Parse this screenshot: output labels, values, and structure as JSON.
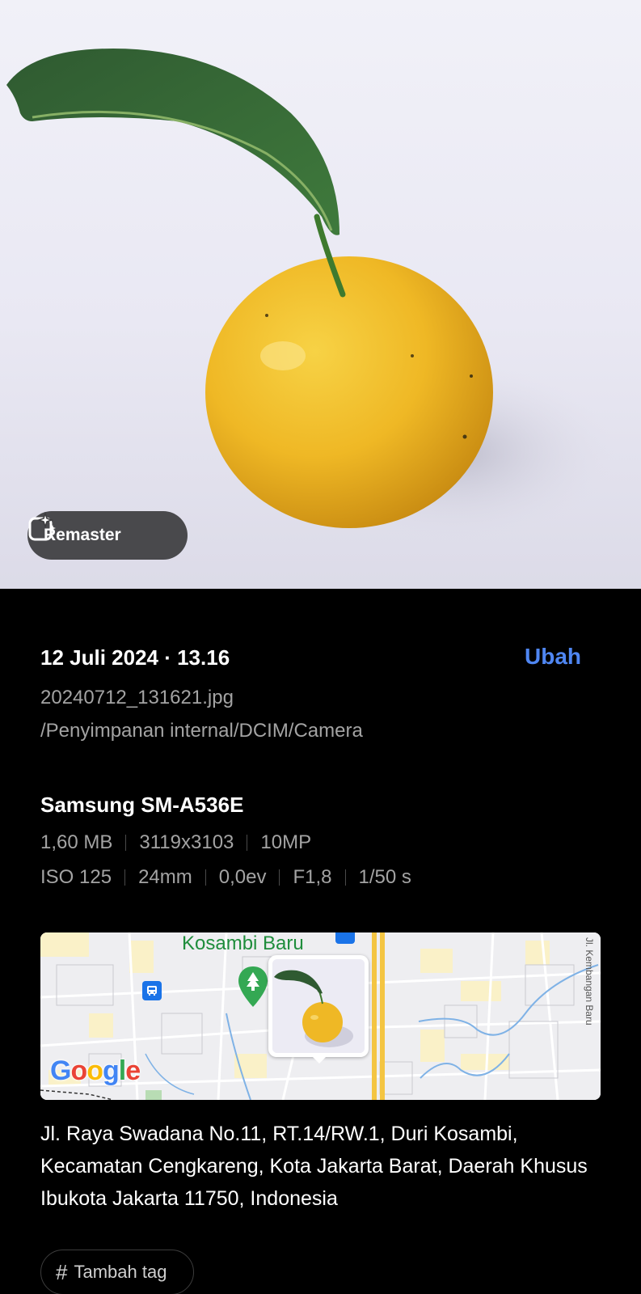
{
  "photo": {
    "remaster_label": "Remaster",
    "remaster_icon": "sparkle-frame-icon"
  },
  "details": {
    "datetime": "12 Juli 2024 · 13.16",
    "edit_label": "Ubah",
    "filename": "20240712_131621.jpg",
    "path": "/Penyimpanan internal/DCIM/Camera"
  },
  "camera": {
    "device": "Samsung SM-A536E",
    "file_specs": [
      "1,60 MB",
      "3119x3103",
      "10MP"
    ],
    "exposure_specs": [
      "ISO 125",
      "24mm",
      "0,0ev",
      "F1,8",
      "1/50 s"
    ]
  },
  "map": {
    "area_label": "Kosambi Baru",
    "road_label": "Jl. Kembangan Baru",
    "google_letters": [
      "G",
      "o",
      "o",
      "g",
      "l",
      "e"
    ],
    "colors": {
      "accent": "#4f86f2",
      "park_pin": "#34a853",
      "transit": "#1a73e8",
      "major_road": "#f4c542"
    }
  },
  "location": {
    "address": "Jl. Raya Swadana No.11, RT.14/RW.1, Duri Kosambi, Kecamatan Cengkareng, Kota Jakarta Barat, Daerah Khusus Ibukota Jakarta 11750, Indonesia"
  },
  "tags": {
    "add_tag_label": "Tambah tag",
    "add_tag_icon": "hash-icon"
  }
}
